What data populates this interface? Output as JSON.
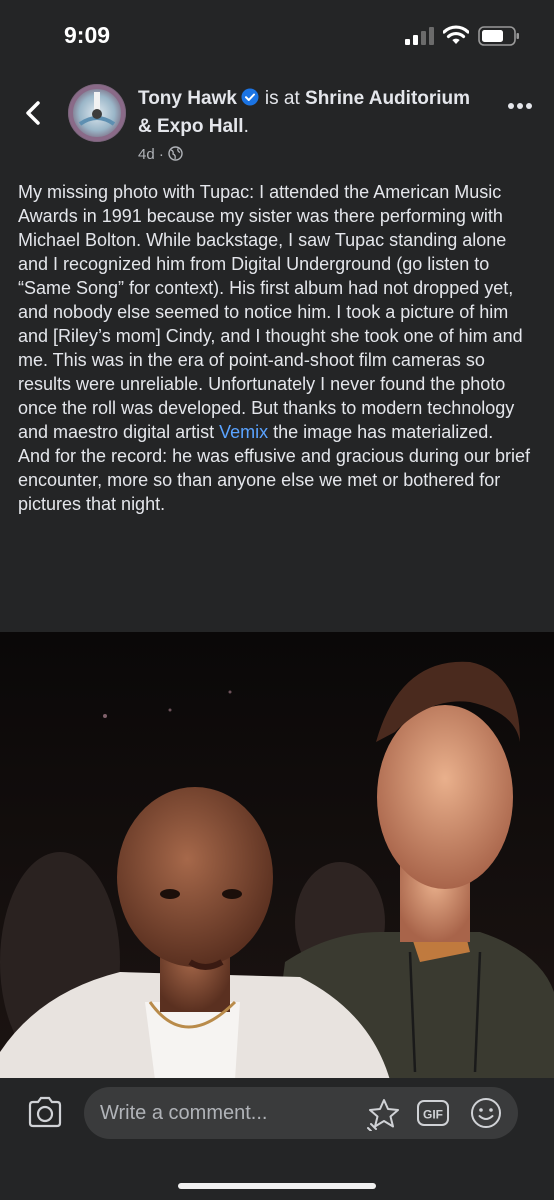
{
  "status_bar": {
    "time": "9:09"
  },
  "post": {
    "author": "Tony Hawk",
    "is_at": "is at",
    "place": "Shrine Auditorium & Expo Hall",
    "period": ".",
    "age": "4d",
    "text_part1": "My missing photo with Tupac: I attended the American Music Awards in 1991 because my sister was there performing with Michael Bolton. While backstage, I saw Tupac standing alone and I recognized him from Digital Underground (go listen to “Same Song” for context). His first album had not dropped yet, and nobody else seemed to notice him. I took a picture of him and [Riley’s mom] Cindy, and I thought she took one of him and me. This was in the era of point-and-shoot film cameras so results were unreliable. Unfortunately I never found the photo once the roll was developed. But thanks to modern technology and maestro digital artist ",
    "link": "Vemix",
    "text_part2": " the image has materialized.\nAnd for the record: he was effusive and gracious during our brief encounter, more so than anyone else we met or bothered for pictures that night."
  },
  "comment": {
    "placeholder": "Write a comment..."
  },
  "colors": {
    "background": "#242526",
    "link": "#5aa3ff",
    "verified": "#1b74e4",
    "input": "#3a3b3c"
  }
}
